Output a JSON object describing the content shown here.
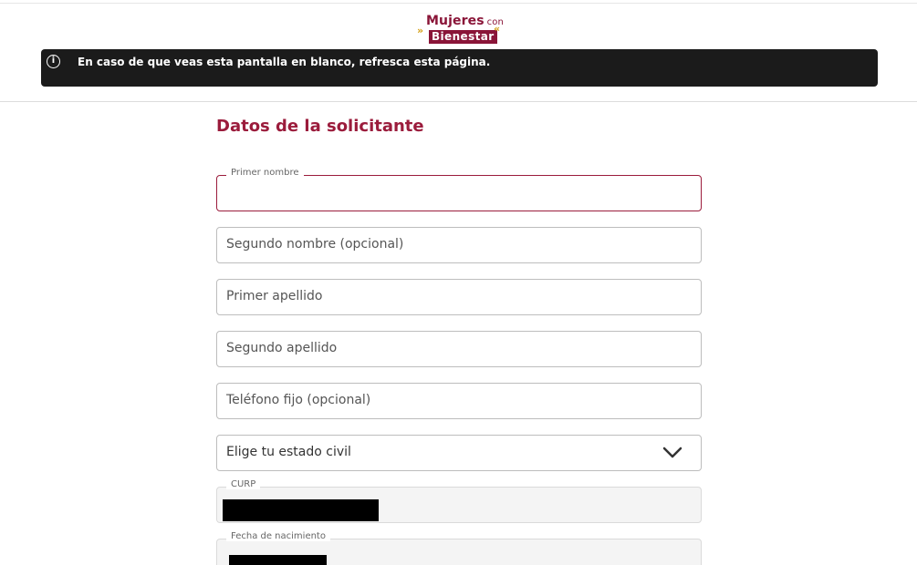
{
  "brand": {
    "line1": "Mujeres",
    "line1_small": "con",
    "line2": "Bienestar",
    "accent_color": "#8a1538",
    "gold_color": "#d4a017"
  },
  "banner": {
    "icon": "info-icon",
    "message": "En caso de que veas esta pantalla en blanco, refresca esta página."
  },
  "section": {
    "title": "Datos de la solicitante"
  },
  "form": {
    "primer_nombre_label": "Primer nombre",
    "segundo_nombre_placeholder": "Segundo nombre (opcional)",
    "primer_apellido_placeholder": "Primer apellido",
    "segundo_apellido_placeholder": "Segundo apellido",
    "telefono_placeholder": "Teléfono fijo (opcional)",
    "estado_civil_placeholder": "Elige tu estado civil",
    "curp_label": "CURP",
    "fecha_label": "Fecha de nacimiento"
  }
}
